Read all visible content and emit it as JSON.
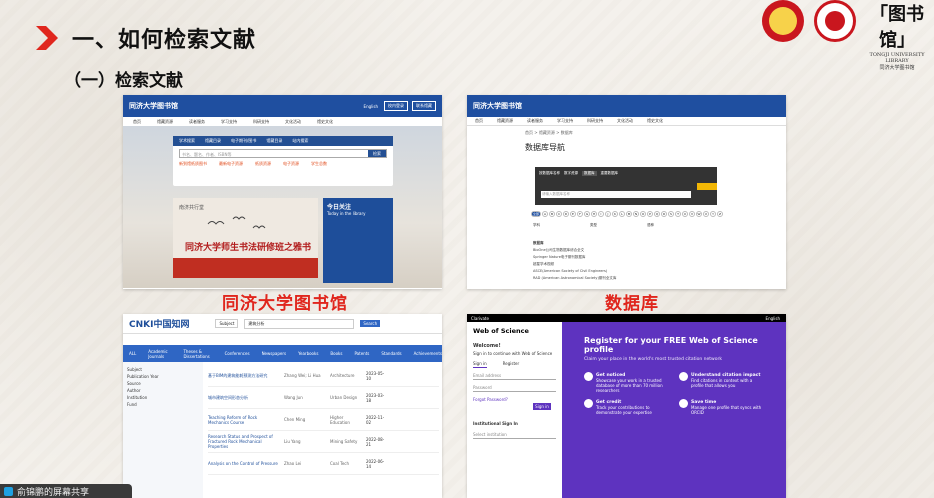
{
  "header": {
    "title": "一、如何检索文献",
    "subtitle": "（一）检索文献",
    "library_logo_cn": "「图书馆」",
    "library_logo_en": "TONGJI UNIVERSITY LIBRARY",
    "library_logo_sub": "同济大学图书馆"
  },
  "captions": {
    "library": "同济大学图书馆",
    "database": "数据库"
  },
  "shot1": {
    "site_name": "同济大学图书馆",
    "site_en": "TONGJI UNIVERSITY LIBRARY",
    "lang": "English",
    "btn1": "校内登录",
    "btn2": "联系馆藏",
    "nav": [
      "首页",
      "馆藏资源",
      "读者服务",
      "学习支持",
      "科研支持",
      "文化活动",
      "馆史文化"
    ],
    "tabs": [
      "学术搜索",
      "馆藏目录",
      "电子期刊/图书",
      "馆藏目录",
      "站内搜索"
    ],
    "search_placeholder": "书名、题名、作者、ISBN等",
    "search_btn": "检索",
    "stats": [
      "新到馆纸质图书",
      "最新电子资源",
      "纸质资源",
      "电子资源",
      "学生总数"
    ],
    "banner_label": "南济共行堂",
    "banner_text": "同济大学师生书法研修班之雅书",
    "right_title": "今日关注",
    "right_sub": "Today in the library"
  },
  "shot2": {
    "site_name": "同济大学图书馆",
    "nav": [
      "首页",
      "馆藏资源",
      "读者服务",
      "学习支持",
      "科研支持",
      "文化活动",
      "馆史文化"
    ],
    "breadcrumb": "首页 > 馆藏资源 > 数据库",
    "heading": "数据库导航",
    "tabs": [
      "按数据库名称",
      "数字资源",
      "数据库",
      "重要数据库"
    ],
    "search_placeholder": "请输入数据库名称",
    "alpha": [
      "全部",
      "A",
      "B",
      "C",
      "D",
      "E",
      "F",
      "G",
      "H",
      "I",
      "J",
      "K",
      "L",
      "M",
      "N",
      "O",
      "P",
      "Q",
      "R",
      "S",
      "T",
      "U",
      "V",
      "W",
      "X",
      "Y",
      "Z"
    ],
    "filters": [
      "学科",
      "类型",
      "语种"
    ],
    "list_title": "数据库",
    "list": [
      "BioOne公司生物数据库综合全文",
      "Springer Nature电子期刊数据库",
      "超星学术视频",
      "ASCE(American Society of Civil Engineers)",
      "RAD (American Astronomical Society)期刊全文库"
    ]
  },
  "shot3": {
    "logo": "CNKI中国知网",
    "subject_btn": "Subject",
    "search_value": "建筑分析",
    "search_btn": "Search",
    "bar": [
      "ALL",
      "Academic Journals",
      "Theses & Dissertations",
      "Conferences",
      "Newspapers",
      "Yearbooks",
      "Books",
      "Patents",
      "Standards",
      "Achievements"
    ],
    "side": [
      "Subject",
      "Publication Year",
      "Source",
      "Author",
      "Institution",
      "Fund"
    ],
    "results": [
      {
        "title": "基于BIM的建筑能耗预测方法研究",
        "author": "Zhang Wei; Li Hua",
        "journal": "Architecture",
        "date": "2023-05-10"
      },
      {
        "title": "城市建筑空间形态分析",
        "author": "Wang Jun",
        "journal": "Urban Design",
        "date": "2023-03-18"
      },
      {
        "title": "Teaching Reform of Rock Mechanics Course",
        "author": "Chen Ming",
        "journal": "Higher Education",
        "date": "2022-11-02"
      },
      {
        "title": "Research Status and Prospect of Fractured Rock Mechanical Properties",
        "author": "Liu Yang",
        "journal": "Mining Safety",
        "date": "2022-08-21"
      },
      {
        "title": "Analysis on the Control of Pressure",
        "author": "Zhao Lei",
        "journal": "Coal Tech",
        "date": "2022-06-14"
      }
    ]
  },
  "shot4": {
    "topbar_left": "Clarivate",
    "topbar_right": "English",
    "brand": "Web of Science",
    "welcome": "Welcome!",
    "signin_prompt": "Sign in to continue with Web of Science",
    "tab_signin": "Sign in",
    "tab_register": "Register",
    "email_label": "Email address",
    "password_label": "Password",
    "forgot": "Forgot Password?",
    "signin_btn": "Sign in",
    "inst_signin": "Institutional Sign In",
    "select_inst": "Select institution",
    "promo_title": "Register for your FREE Web of Science profile",
    "promo_sub": "Claim your place in the world's most trusted citation network",
    "features": [
      {
        "title": "Get noticed",
        "text": "Showcase your work in a trusted database of more than 70 million researchers"
      },
      {
        "title": "Understand citation impact",
        "text": "Find citations in context with a profile that allows you"
      },
      {
        "title": "Get credit",
        "text": "Track your contributions to demonstrate your expertise"
      },
      {
        "title": "Save time",
        "text": "Manage one profile that syncs with ORCID"
      }
    ]
  },
  "taskbar": {
    "label": "俞锦鹏的屏幕共享"
  }
}
